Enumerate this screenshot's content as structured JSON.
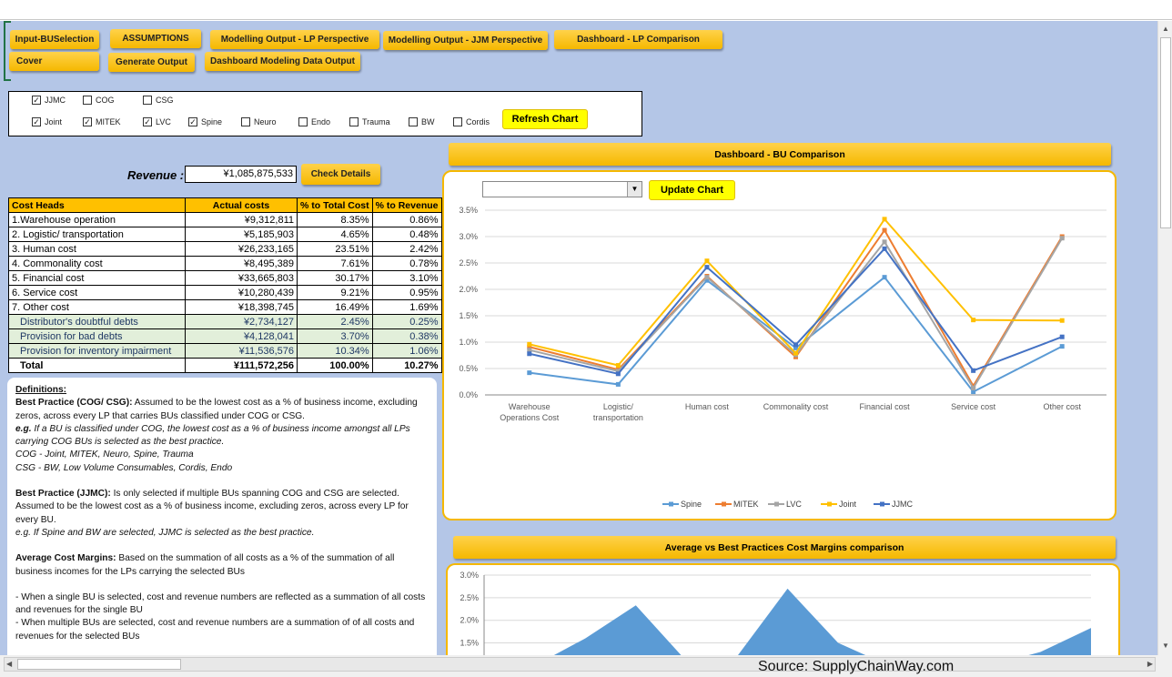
{
  "nav_buttons": [
    "Input-BUSelection",
    "ASSUMPTIONS",
    "Modelling Output - LP Perspective",
    "Modelling Output - JJM Perspective",
    "Dashboard - LP Comparison",
    "Cover",
    "Generate Output",
    "Dashboard Modeling Data Output"
  ],
  "bu_selection": {
    "items": [
      {
        "label": "JJMC",
        "checked": true
      },
      {
        "label": "COG",
        "checked": false
      },
      {
        "label": "CSG",
        "checked": false
      },
      {
        "label": "Joint",
        "checked": true
      },
      {
        "label": "MITEK",
        "checked": true
      },
      {
        "label": "LVC",
        "checked": true
      },
      {
        "label": "Spine",
        "checked": true
      },
      {
        "label": "Neuro",
        "checked": false
      },
      {
        "label": "Endo",
        "checked": false
      },
      {
        "label": "Trauma",
        "checked": false
      },
      {
        "label": "BW",
        "checked": false
      },
      {
        "label": "Cordis",
        "checked": false
      }
    ],
    "refresh_label": "Refresh Chart"
  },
  "revenue": {
    "label": "Revenue :",
    "value": "¥1,085,875,533",
    "check_label": "Check Details"
  },
  "cost_table": {
    "headers": [
      "Cost Heads",
      "Actual costs",
      "% to Total Cost",
      "% to Revenue"
    ],
    "rows": [
      [
        "1.Warehouse operation",
        "¥9,312,811",
        "8.35%",
        "0.86%"
      ],
      [
        "2. Logistic/ transportation",
        "¥5,185,903",
        "4.65%",
        "0.48%"
      ],
      [
        "3. Human cost",
        "¥26,233,165",
        "23.51%",
        "2.42%"
      ],
      [
        "4. Commonality cost",
        "¥8,495,389",
        "7.61%",
        "0.78%"
      ],
      [
        "5. Financial cost",
        "¥33,665,803",
        "30.17%",
        "3.10%"
      ],
      [
        "6. Service cost",
        "¥10,280,439",
        "9.21%",
        "0.95%"
      ],
      [
        "7. Other cost",
        "¥18,398,745",
        "16.49%",
        "1.69%"
      ],
      [
        "Distributor's doubtful debts",
        "¥2,734,127",
        "2.45%",
        "0.25%"
      ],
      [
        "Provision for bad debts",
        "¥4,128,041",
        "3.70%",
        "0.38%"
      ],
      [
        "Provision for inventory impairment",
        "¥11,536,576",
        "10.34%",
        "1.06%"
      ],
      [
        "Total",
        "¥111,572,256",
        "100.00%",
        "10.27%"
      ]
    ]
  },
  "definitions": {
    "title": "Definitions:",
    "bp_cog_head": "Best Practice (COG/ CSG):",
    "bp_cog_text": " Assumed to be the lowest cost as a % of business income, excluding zeros, across every LP that carries BUs classified under COG or CSG.",
    "eg1_head": "e.g.",
    "eg1_text": " If a BU is classified under COG, the lowest cost as a % of business income amongst all LPs carrying COG BUs is selected as the best practice.",
    "cog_list": "COG - Joint, MITEK, Neuro, Spine, Trauma",
    "csg_list": "CSG - BW, Low Volume Consumables, Cordis, Endo",
    "bp_jjmc_head": "Best Practice (JJMC):",
    "bp_jjmc_text": " Is only selected if multiple BUs spanning COG and CSG are selected. Assumed to be the lowest cost as a % of business income, excluding zeros, across every LP for every BU.",
    "eg2": "e.g. If Spine and BW are selected, JJMC is selected as the best practice.",
    "acm_head": "Average Cost Margins:",
    "acm_text": " Based on the summation of all costs as a % of the summation of all business incomes for the LPs carrying the selected BUs",
    "note1": "- When a single BU is selected, cost and revenue numbers are reflected as a summation of all costs and revenues for the single BU",
    "note2": "- When multiple BUs are selected, cost and revenue numbers are a summation of of all costs and revenues for the selected BUs"
  },
  "dashboard_title": "Dashboard - BU Comparison",
  "dropdown_value": "",
  "update_label": "Update Chart",
  "comparison_title": "Average vs Best Practices Cost Margins comparison",
  "source": "Source: SupplyChainWay.com",
  "chart_data": [
    {
      "type": "line",
      "categories": [
        "Warehouse Operations Cost",
        "Logistic/ transportation",
        "Human cost",
        "Commonality cost",
        "Financial cost",
        "Service cost",
        "Other cost"
      ],
      "ylim": [
        0,
        3.5
      ],
      "yticks": [
        "0.0%",
        "0.5%",
        "1.0%",
        "1.5%",
        "2.0%",
        "2.5%",
        "3.0%",
        "3.5%"
      ],
      "grid": true,
      "legend": "bottom",
      "series": [
        {
          "name": "Spine",
          "color": "#5b9bd5",
          "values": [
            0.42,
            0.2,
            2.17,
            0.89,
            2.23,
            0.06,
            0.92
          ]
        },
        {
          "name": "MITEK",
          "color": "#ed7d31",
          "values": [
            0.91,
            0.48,
            2.25,
            0.72,
            3.12,
            0.17,
            3.0
          ]
        },
        {
          "name": "LVC",
          "color": "#a5a5a5",
          "values": [
            0.85,
            0.45,
            2.23,
            0.76,
            2.9,
            0.13,
            2.97
          ]
        },
        {
          "name": "Joint",
          "color": "#ffc000",
          "values": [
            0.96,
            0.56,
            2.54,
            0.79,
            3.33,
            1.42,
            1.41
          ]
        },
        {
          "name": "JJMC",
          "color": "#4472c4",
          "values": [
            0.78,
            0.4,
            2.42,
            0.95,
            2.77,
            0.46,
            1.1
          ]
        }
      ]
    },
    {
      "type": "area",
      "ylim": [
        0,
        3.0
      ],
      "yticks": [
        "1.5%",
        "2.0%",
        "2.5%",
        "3.0%"
      ],
      "grid": true,
      "color": "#5b9bd5",
      "values": [
        1.0,
        1.0,
        1.6,
        2.33,
        1.1,
        1.2,
        2.7,
        1.5,
        1.0,
        1.0,
        1.0,
        1.3,
        1.83
      ]
    }
  ]
}
